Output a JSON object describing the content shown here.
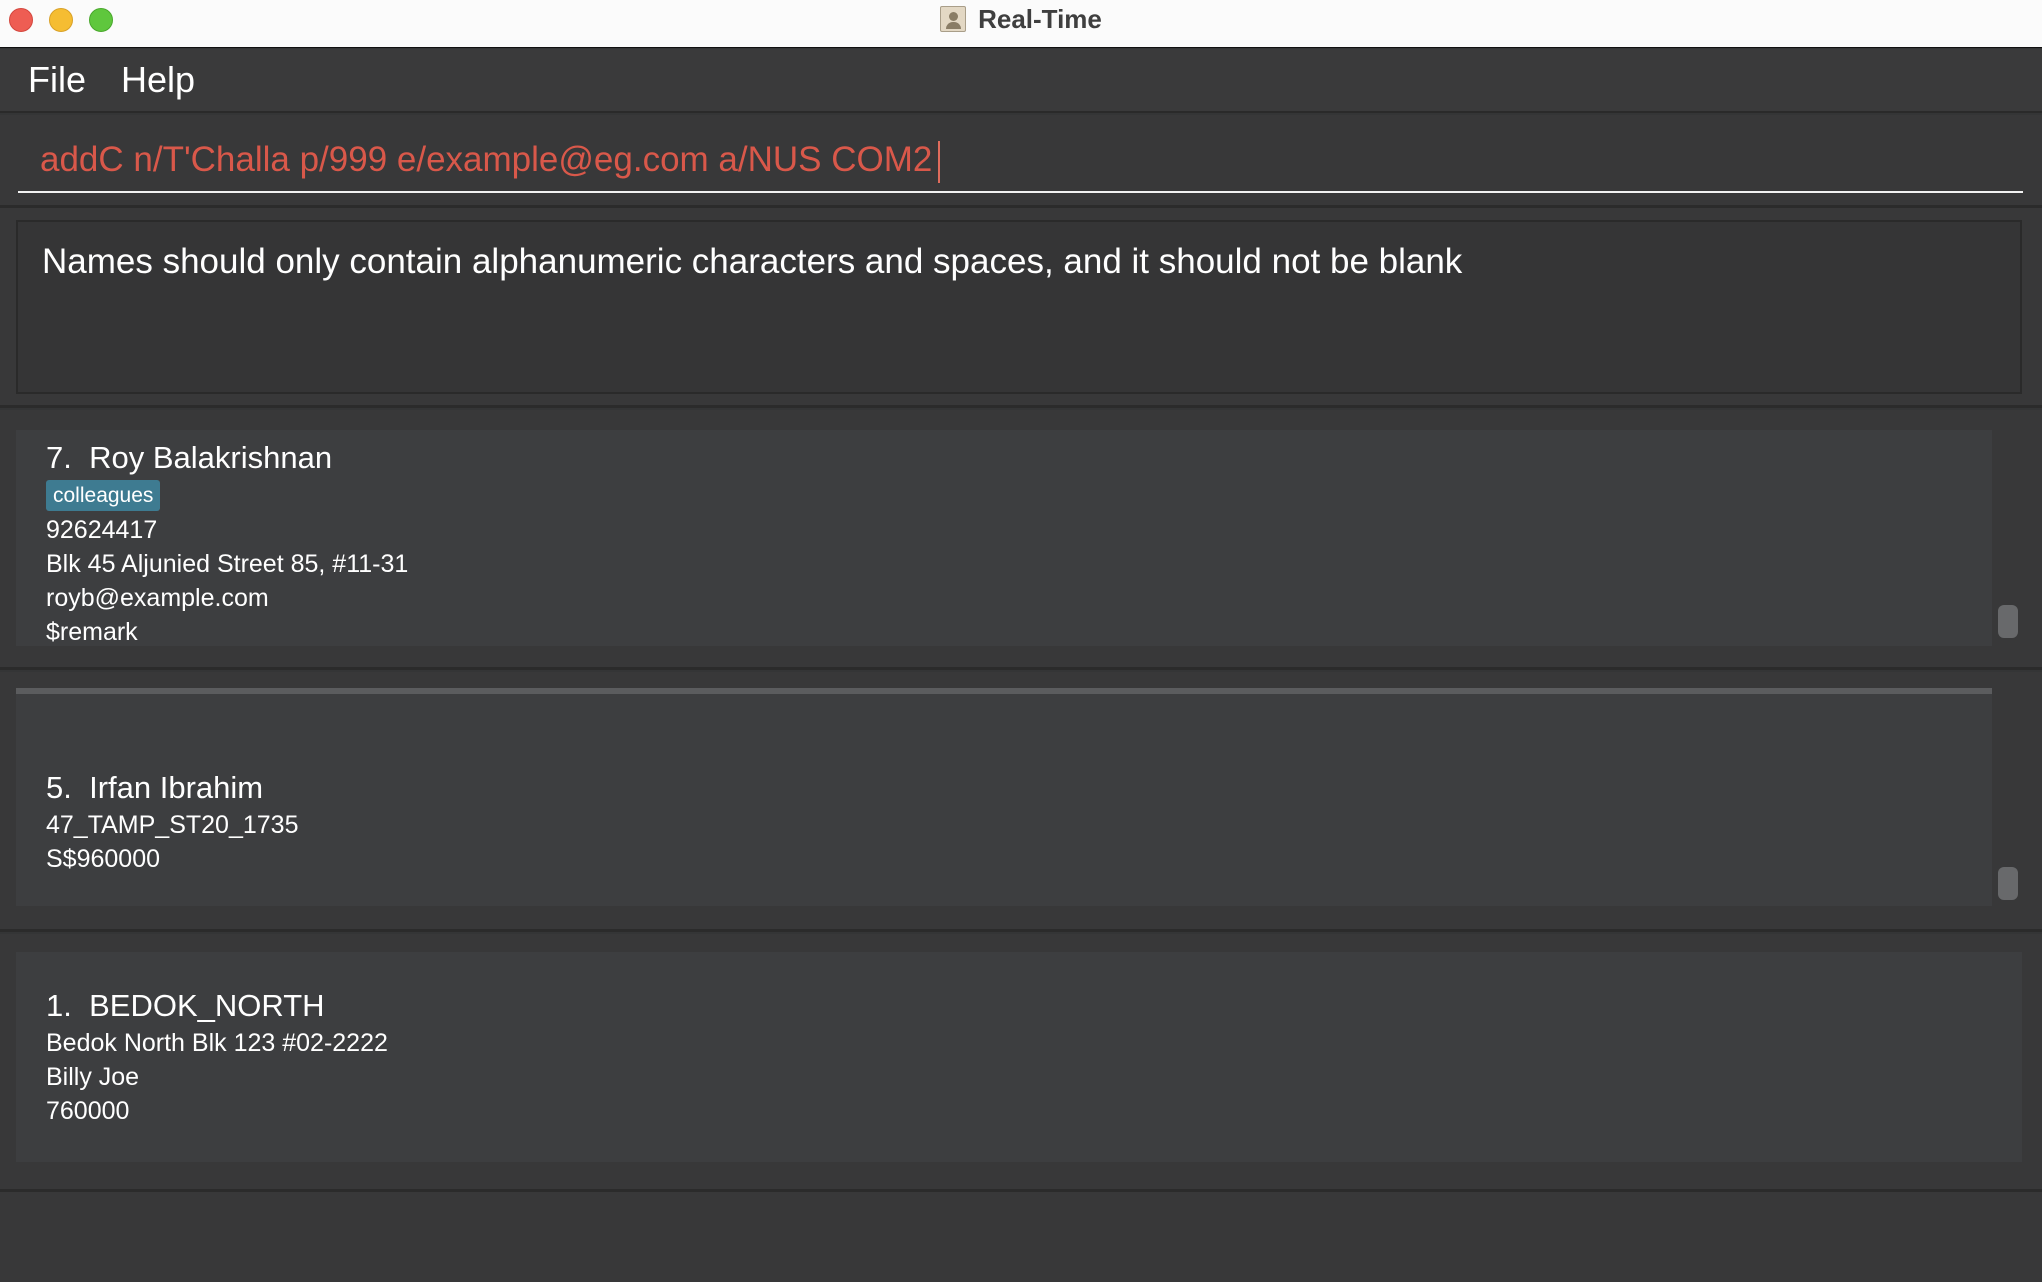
{
  "window": {
    "title": "Real-Time",
    "app_icon": "address-book-icon"
  },
  "menu": {
    "file": "File",
    "help": "Help"
  },
  "command": {
    "value": "addC n/T'Challa p/999 e/example@eg.com a/NUS COM2"
  },
  "result": {
    "message": "Names should only contain alphanumeric characters and spaces, and it should not be blank"
  },
  "contacts": {
    "items": [
      {
        "index": "7.",
        "name": "Roy Balakrishnan",
        "tag": "colleagues",
        "phone": "92624417",
        "address": "Blk 45 Aljunied Street 85, #11-31",
        "email": "royb@example.com",
        "remark": "$remark"
      }
    ]
  },
  "properties": {
    "items": [
      {
        "index": "5.",
        "name": "Irfan Ibrahim",
        "property_id": "47_TAMP_ST20_1735",
        "price": "S$960000"
      }
    ]
  },
  "meetups": {
    "items": [
      {
        "index": "1.",
        "name": "BEDOK_NORTH",
        "address": "Bedok North Blk 123 #02-2222",
        "contact": "Billy Joe",
        "postal": "760000"
      }
    ]
  },
  "colors": {
    "command_text": "#d9584a",
    "tag_bg": "#3e7b91",
    "panel_bg": "#383839",
    "card_bg": "#3d3e40"
  }
}
